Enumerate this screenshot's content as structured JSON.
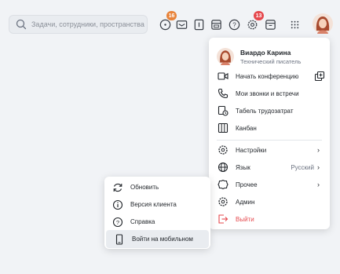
{
  "search": {
    "placeholder": "Задачи, сотрудники, пространства"
  },
  "toolbar": {
    "notifications_badge": "16",
    "calls_badge": "13"
  },
  "profile": {
    "name": "Виардо Карина",
    "role": "Технический писатель"
  },
  "menu": {
    "items": [
      {
        "label": "Начать конференцию"
      },
      {
        "label": "Мои звонки и встречи"
      },
      {
        "label": "Табель трудозатрат"
      },
      {
        "label": "Канбан"
      },
      {
        "label": "Настройки"
      },
      {
        "label": "Язык",
        "value": "Русский"
      },
      {
        "label": "Прочее"
      },
      {
        "label": "Админ"
      },
      {
        "label": "Выйти"
      }
    ]
  },
  "submenu": {
    "items": [
      {
        "label": "Обновить"
      },
      {
        "label": "Версия клиента"
      },
      {
        "label": "Справка"
      },
      {
        "label": "Войти на мобильном"
      }
    ]
  },
  "colors": {
    "danger": "#e5484d",
    "badge_orange": "#e8833a",
    "badge_red": "#e5484d"
  }
}
